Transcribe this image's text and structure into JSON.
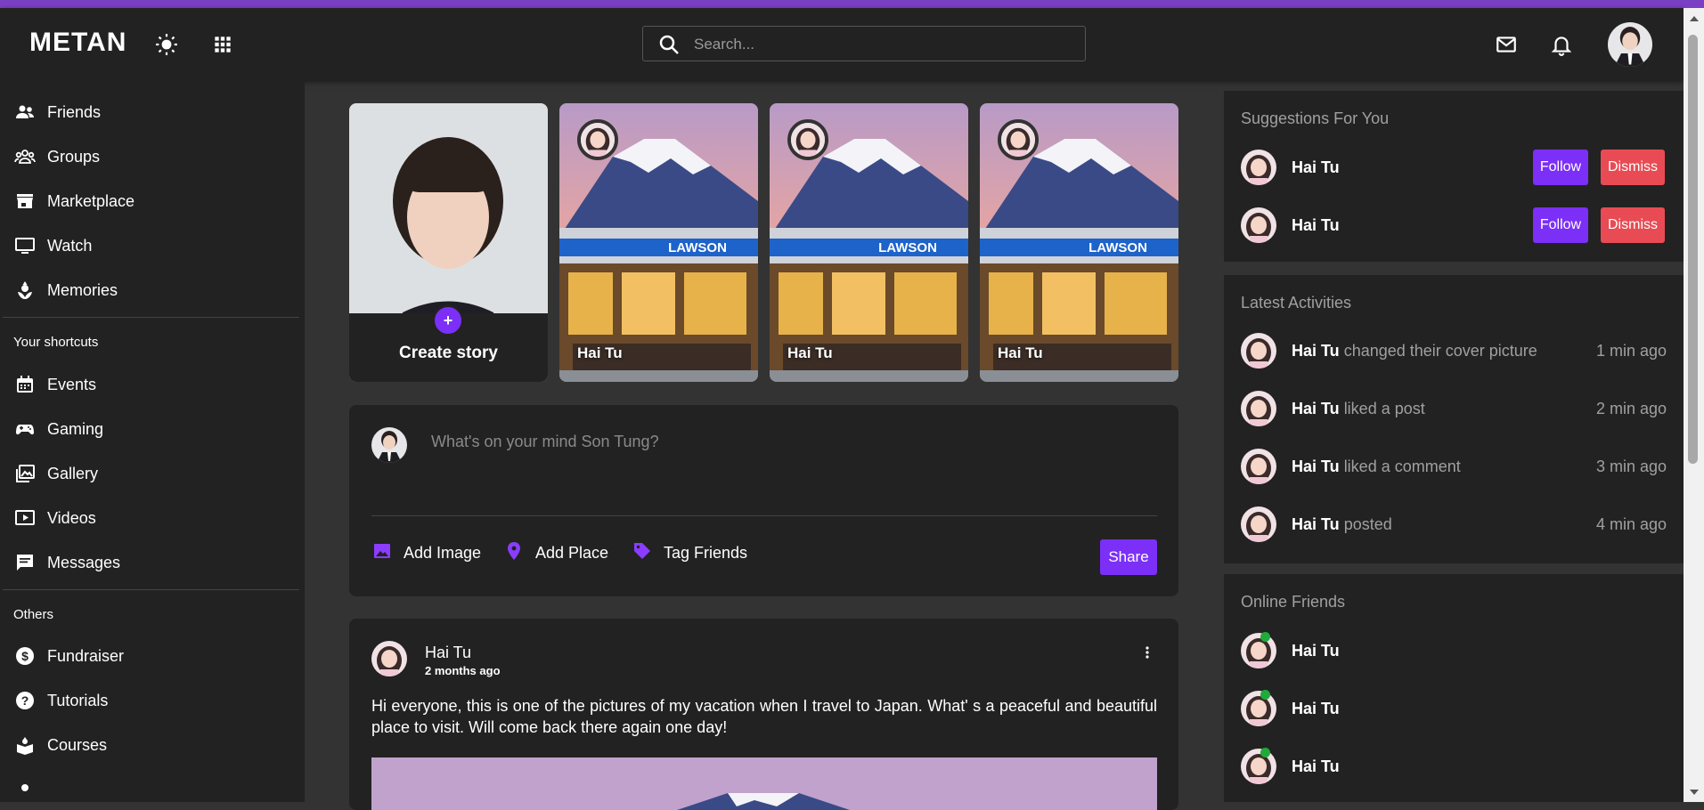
{
  "app": {
    "logo": "METAN"
  },
  "colors": {
    "accent": "#7b2ff7",
    "danger": "#e94b54",
    "online": "#1faa3a",
    "stripe": "#7b3fc4"
  },
  "header": {
    "search_placeholder": "Search...",
    "icons": [
      "sun-icon",
      "apps-grid-icon",
      "search-icon",
      "mail-icon",
      "bell-icon"
    ]
  },
  "sidebar": {
    "main": [
      {
        "label": "Friends",
        "icon": "friends-icon"
      },
      {
        "label": "Groups",
        "icon": "groups-icon"
      },
      {
        "label": "Marketplace",
        "icon": "store-icon"
      },
      {
        "label": "Watch",
        "icon": "monitor-icon"
      },
      {
        "label": "Memories",
        "icon": "memories-icon"
      }
    ],
    "shortcuts_heading": "Your shortcuts",
    "shortcuts": [
      {
        "label": "Events",
        "icon": "calendar-icon"
      },
      {
        "label": "Gaming",
        "icon": "gamepad-icon"
      },
      {
        "label": "Gallery",
        "icon": "gallery-icon"
      },
      {
        "label": "Videos",
        "icon": "video-icon"
      },
      {
        "label": "Messages",
        "icon": "message-icon"
      }
    ],
    "others_heading": "Others",
    "others": [
      {
        "label": "Fundraiser",
        "icon": "dollar-icon"
      },
      {
        "label": "Tutorials",
        "icon": "help-icon"
      },
      {
        "label": "Courses",
        "icon": "courses-icon"
      }
    ]
  },
  "stories": {
    "create_label": "Create story",
    "items": [
      {
        "name": "Hai Tu",
        "scene_sign": "LAWSON"
      },
      {
        "name": "Hai Tu",
        "scene_sign": "LAWSON"
      },
      {
        "name": "Hai Tu",
        "scene_sign": "LAWSON"
      }
    ]
  },
  "composer": {
    "placeholder": "What's on your mind Son Tung?",
    "actions": [
      {
        "label": "Add Image",
        "icon": "image-icon"
      },
      {
        "label": "Add Place",
        "icon": "location-pin-icon"
      },
      {
        "label": "Tag Friends",
        "icon": "tag-icon"
      }
    ],
    "share_label": "Share"
  },
  "post": {
    "author": "Hai Tu",
    "time": "2 months ago",
    "text": "Hi everyone, this is one of the pictures of my vacation when I travel to Japan. What' s a peaceful and beautiful place to visit. Will come back there again one day!"
  },
  "suggestions": {
    "title": "Suggestions For You",
    "items": [
      {
        "name": "Hai Tu",
        "follow": "Follow",
        "dismiss": "Dismiss"
      },
      {
        "name": "Hai Tu",
        "follow": "Follow",
        "dismiss": "Dismiss"
      }
    ]
  },
  "activities": {
    "title": "Latest Activities",
    "items": [
      {
        "name": "Hai Tu",
        "action": "changed their cover picture",
        "time": "1 min ago"
      },
      {
        "name": "Hai Tu",
        "action": "liked a post",
        "time": "2 min ago"
      },
      {
        "name": "Hai Tu",
        "action": "liked a comment",
        "time": "3 min ago"
      },
      {
        "name": "Hai Tu",
        "action": "posted",
        "time": "4 min ago"
      }
    ]
  },
  "online_friends": {
    "title": "Online Friends",
    "items": [
      {
        "name": "Hai Tu"
      },
      {
        "name": "Hai Tu"
      },
      {
        "name": "Hai Tu"
      }
    ]
  }
}
